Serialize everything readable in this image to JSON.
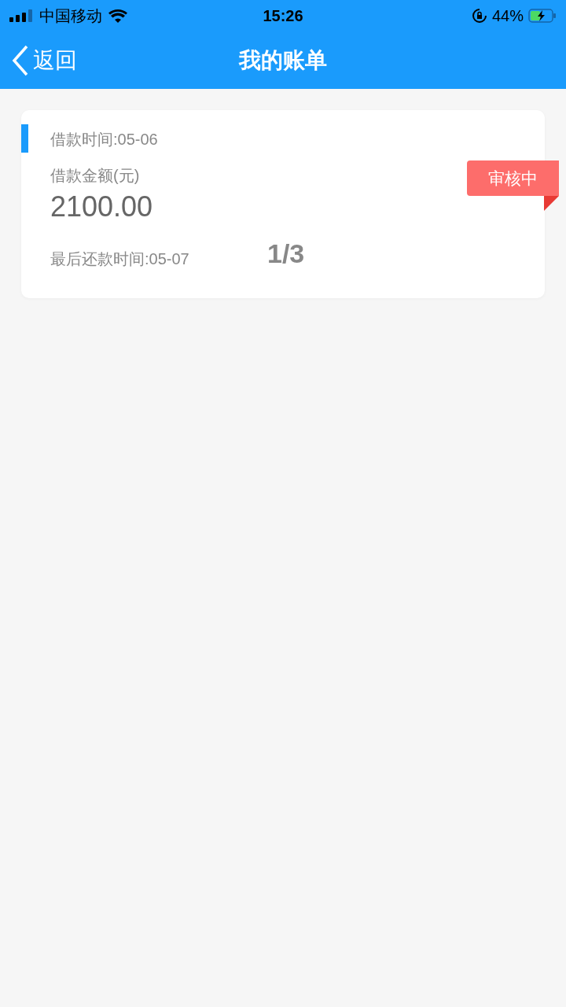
{
  "status_bar": {
    "carrier": "中国移动",
    "time": "15:26",
    "battery": "44%"
  },
  "nav": {
    "back": "返回",
    "title": "我的账单"
  },
  "bills": [
    {
      "loan_date": "借款时间:05-06",
      "amount_label": "借款金额(元)",
      "amount": "2100.00",
      "due_date": "最后还款时间:05-07",
      "period": "1/3",
      "status": "审核中"
    }
  ]
}
